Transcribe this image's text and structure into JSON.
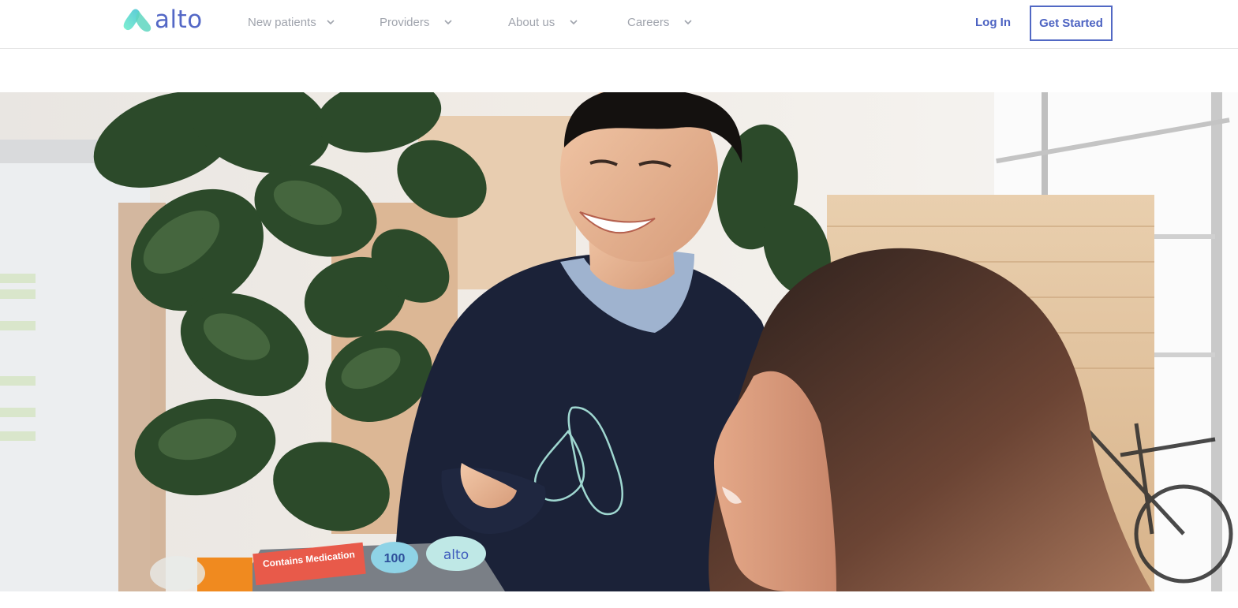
{
  "header": {
    "logo": {
      "text": "alto",
      "icon": "alto-logo-icon"
    },
    "nav": [
      {
        "label": "New patients",
        "icon": "chevron-down-icon"
      },
      {
        "label": "Providers",
        "icon": "chevron-down-icon"
      },
      {
        "label": "About us",
        "icon": "chevron-down-icon"
      },
      {
        "label": "Careers",
        "icon": "chevron-down-icon"
      }
    ],
    "login_label": "Log In",
    "cta_label": "Get Started"
  },
  "hero": {
    "photo_text": {
      "sticker_medication": "Contains Medication",
      "sticker_100": "100",
      "sticker_alto": "alto"
    }
  },
  "colors": {
    "brand": "#5468c6",
    "brand_mint": "#6fe3c8",
    "nav_text": "#a0a4ad",
    "border": "#e6e6e6"
  }
}
